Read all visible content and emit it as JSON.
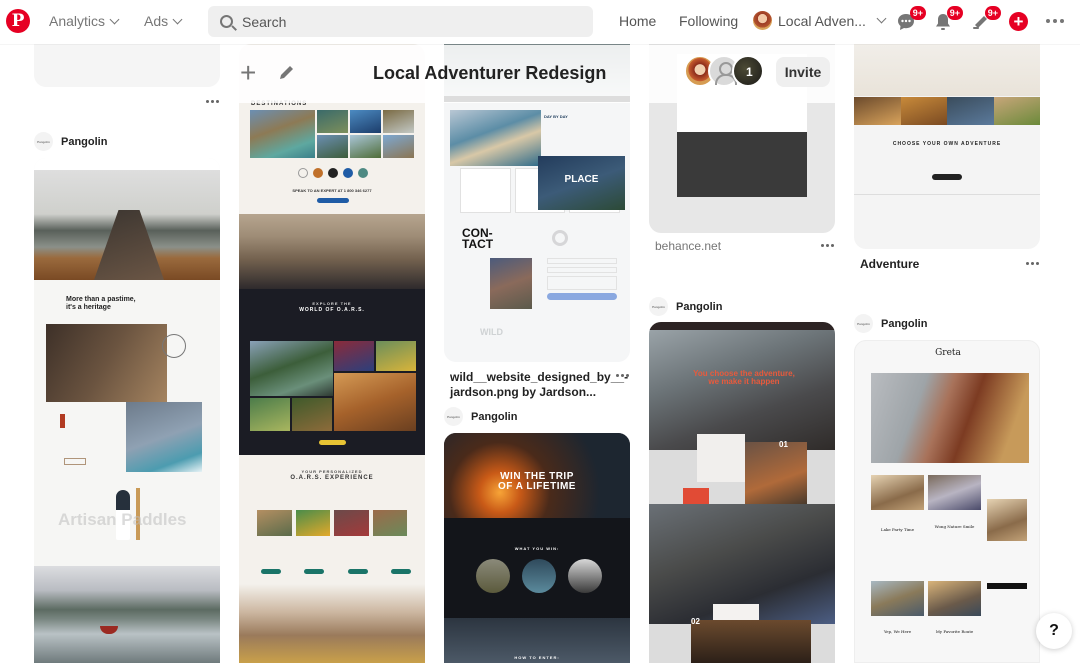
{
  "header": {
    "logo": "P",
    "analytics_label": "Analytics",
    "ads_label": "Ads",
    "search_placeholder": "Search",
    "home_label": "Home",
    "following_label": "Following",
    "profile_name": "Local Adven...",
    "messages_badge": "9+",
    "notifications_badge": "9+",
    "news_badge": "9+",
    "brand_color": "#e60023"
  },
  "board": {
    "title": "Local Adventurer Redesign",
    "add_icon": "plus-icon",
    "edit_icon": "pencil-icon",
    "collaborator_extra_count": "1",
    "invite_label": "Invite"
  },
  "pins": {
    "col1": {
      "pinner": "Pangolin",
      "pinner_avatar": "Pangolin",
      "pin_text_1": "More than a pastime,",
      "pin_text_2": "it's a heritage",
      "pin_text_3": "Artisan Paddles"
    },
    "col2": {
      "heading_top": "DESTINATIONS",
      "speak_text": "SPEAK TO AN EXPERT AT 1 800 346 6277",
      "explore_1": "EXPLORE THE",
      "explore_2": "WORLD OF O.A.R.S.",
      "experience_1": "YOUR PERSONALIZED",
      "experience_2": "O.A.R.S. EXPERIENCE"
    },
    "col3": {
      "title": "wild__website_designed_by__-jardson.png by Jardson...",
      "place_text": "PLACE",
      "contact_text": "CON-\nTACT",
      "wild_text": "WILD",
      "pinner": "Pangolin",
      "pinner_avatar": "Pangolin",
      "win_1": "WIN THE TRIP",
      "win_2": "OF A LIFETIME",
      "what_you_win": "WHAT YOU WIN:",
      "how_to_enter": "HOW TO ENTER:"
    },
    "col4": {
      "source": "behance.net",
      "pinner": "Pangolin",
      "pinner_avatar": "Pangolin",
      "headline": "You choose the adventure, we make it happen",
      "step1": "01",
      "step2": "02"
    },
    "col5": {
      "choose_text": "CHOOSE YOUR OWN ADVENTURE",
      "title": "Adventure",
      "pinner": "Pangolin",
      "pinner_avatar": "Pangolin",
      "greta_title": "Greta",
      "post1": "Lake Party Time",
      "post2": "Wong Nature Smile",
      "post3": "Yep, We Here",
      "post4": "My Favorite Route"
    }
  },
  "help_label": "?"
}
